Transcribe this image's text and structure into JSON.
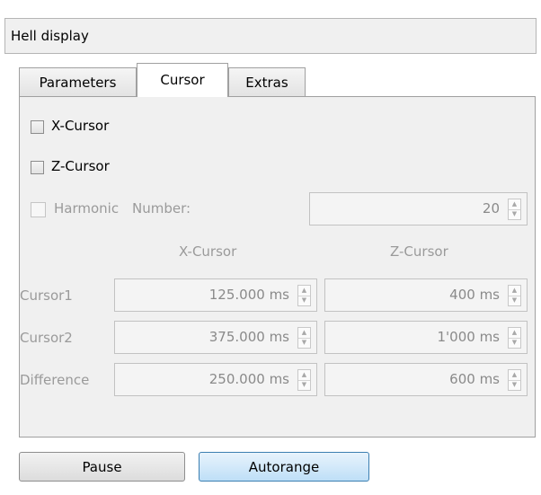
{
  "header": {
    "title": "Hell display"
  },
  "tabs": [
    {
      "label": "Parameters"
    },
    {
      "label": "Cursor"
    },
    {
      "label": "Extras"
    }
  ],
  "active_tab": "Cursor",
  "cursor": {
    "x_cursor": {
      "label": "X-Cursor",
      "checked": false
    },
    "z_cursor": {
      "label": "Z-Cursor",
      "checked": false
    },
    "harmonic": {
      "label": "Harmonic",
      "checked": false,
      "number_label": "Number:",
      "number_value": "20"
    },
    "columns": {
      "x": "X-Cursor",
      "z": "Z-Cursor"
    },
    "rows": [
      {
        "label": "Cursor1",
        "x": "125.000 ms",
        "z": "400 ms"
      },
      {
        "label": "Cursor2",
        "x": "375.000 ms",
        "z": "1'000 ms"
      },
      {
        "label": "Difference",
        "x": "250.000 ms",
        "z": "600 ms"
      }
    ]
  },
  "buttons": {
    "pause": "Pause",
    "autorange": "Autorange"
  },
  "colors": {
    "autorange_button": "#bedff7",
    "panel_bg": "#f0f0f0",
    "disabled_text": "#9a9a9a"
  },
  "icons": {
    "spin_up": "spin-up-arrow-icon",
    "spin_down": "spin-down-arrow-icon"
  }
}
